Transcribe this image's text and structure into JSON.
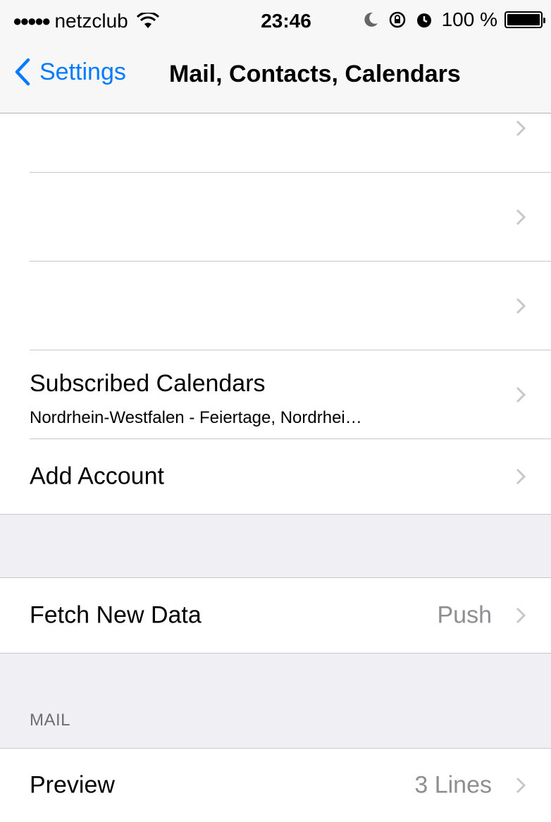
{
  "status_bar": {
    "carrier": "netzclub",
    "time": "23:46",
    "battery_text": "100 %"
  },
  "nav": {
    "back_label": "Settings",
    "title": "Mail, Contacts, Calendars"
  },
  "accounts": {
    "rows": [
      {
        "label": ""
      },
      {
        "label": ""
      },
      {
        "label": ""
      },
      {
        "label": "Subscribed Calendars",
        "subtitle": "Nordrhein-Westfalen - Feiertage, Nordrhei…"
      },
      {
        "label": "Add Account"
      }
    ]
  },
  "fetch": {
    "label": "Fetch New Data",
    "value": "Push"
  },
  "mail_section": {
    "header": "MAIL",
    "preview_label": "Preview",
    "preview_value": "3 Lines"
  },
  "colors": {
    "accent": "#007aff",
    "background": "#efeff4",
    "separator": "#c8c7cc",
    "secondary_text": "#8e8e93"
  }
}
